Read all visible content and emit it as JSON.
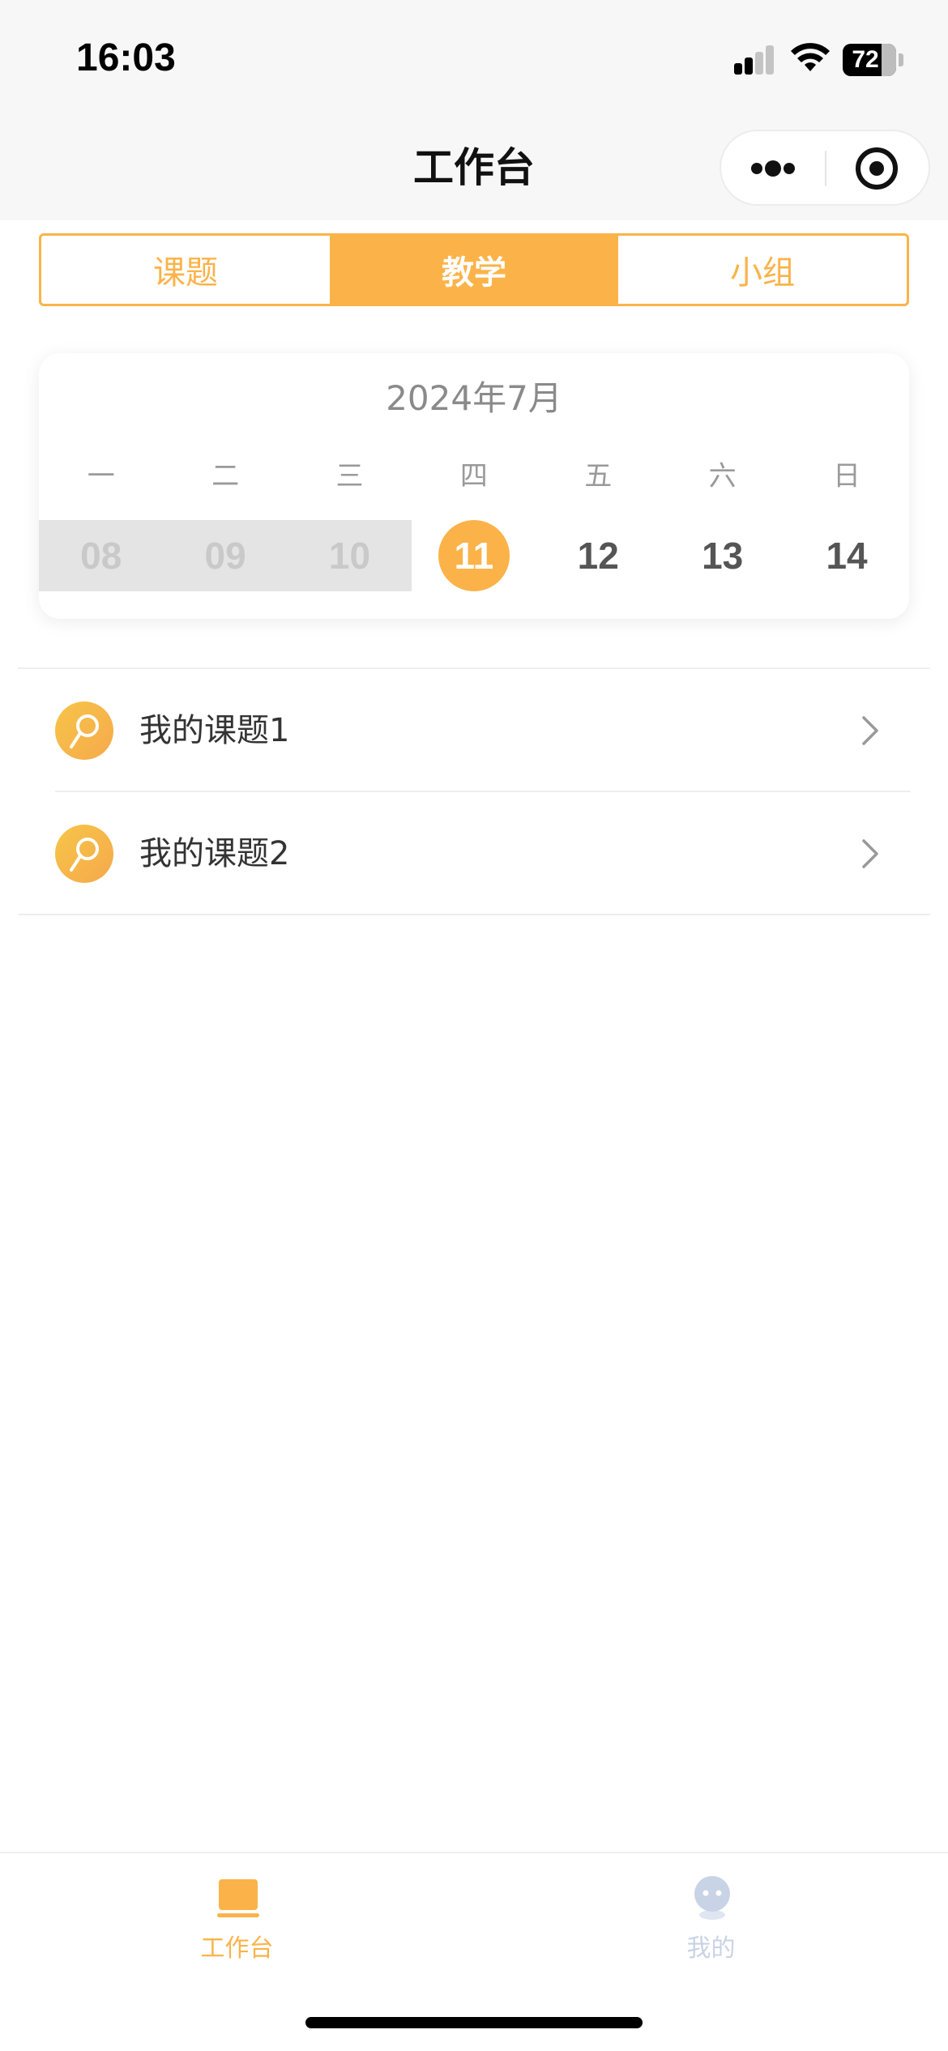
{
  "status_bar": {
    "time": "16:03",
    "battery": "72",
    "icons": [
      "signal-icon",
      "wifi-icon",
      "battery-icon"
    ]
  },
  "nav": {
    "title": "工作台",
    "capsule_icons": [
      "more-dots-icon",
      "target-icon"
    ]
  },
  "segments": [
    {
      "label": "课题",
      "active": false
    },
    {
      "label": "教学",
      "active": true
    },
    {
      "label": "小组",
      "active": false
    }
  ],
  "calendar": {
    "title": "2024年7月",
    "weekdays": [
      "一",
      "二",
      "三",
      "四",
      "五",
      "六",
      "日"
    ],
    "days": [
      {
        "label": "08",
        "state": "past"
      },
      {
        "label": "09",
        "state": "past"
      },
      {
        "label": "10",
        "state": "past"
      },
      {
        "label": "11",
        "state": "today"
      },
      {
        "label": "12",
        "state": "future"
      },
      {
        "label": "13",
        "state": "future"
      },
      {
        "label": "14",
        "state": "future"
      }
    ]
  },
  "list": {
    "items": [
      {
        "label": "我的课题1",
        "icon": "topic-icon"
      },
      {
        "label": "我的课题2",
        "icon": "topic-icon"
      }
    ]
  },
  "tabbar": {
    "items": [
      {
        "label": "工作台",
        "icon": "workbench-icon",
        "active": true
      },
      {
        "label": "我的",
        "icon": "profile-icon",
        "active": false
      }
    ]
  },
  "colors": {
    "accent": "#fbb349",
    "tab_inactive": "#c9d3e6",
    "text": "#333333",
    "muted": "#8a8a8a"
  }
}
